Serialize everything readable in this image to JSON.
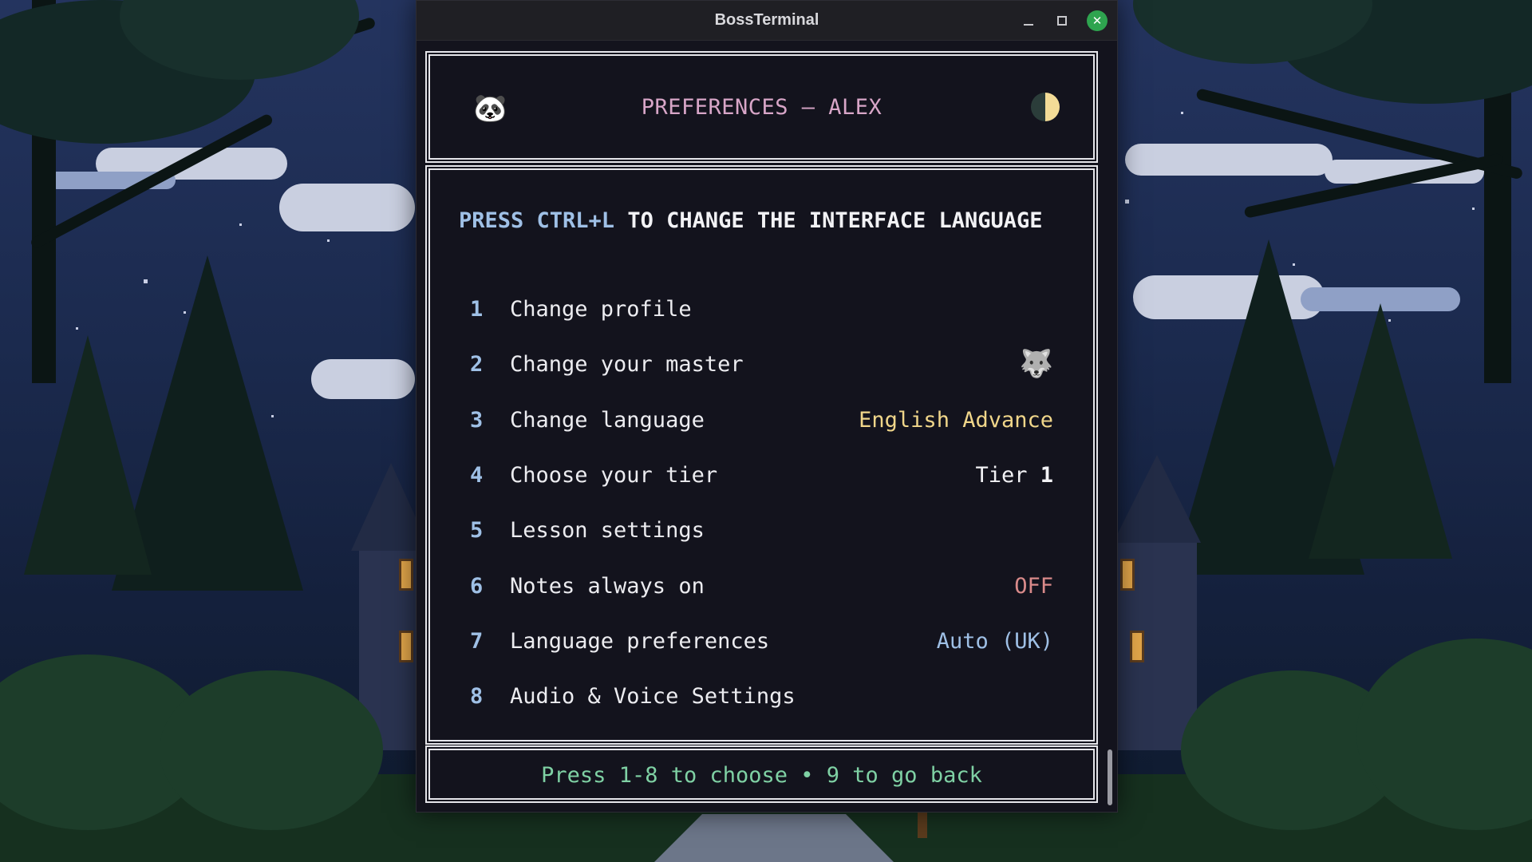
{
  "window": {
    "title": "BossTerminal"
  },
  "header": {
    "title": "PREFERENCES — ALEX",
    "left_icon": "🐼",
    "right_icon": "moon-icon"
  },
  "hint": {
    "shortcut": "PRESS CTRL+L",
    "text": " TO CHANGE THE INTERFACE LANGUAGE"
  },
  "menu": {
    "items": [
      {
        "num": "1",
        "label": "Change profile",
        "value": ""
      },
      {
        "num": "2",
        "label": "Change your master",
        "value": "",
        "icon": "🐺"
      },
      {
        "num": "3",
        "label": "Change language",
        "value": "English Advance"
      },
      {
        "num": "4",
        "label": "Choose your tier",
        "value_prefix": "Tier ",
        "value_strong": "1"
      },
      {
        "num": "5",
        "label": "Lesson settings",
        "value": ""
      },
      {
        "num": "6",
        "label": "Notes always on",
        "value": "OFF"
      },
      {
        "num": "7",
        "label": "Language preferences",
        "value": "Auto (UK)"
      },
      {
        "num": "8",
        "label": "Audio & Voice Settings",
        "value": ""
      }
    ]
  },
  "footer": {
    "hint": "Press 1-8 to choose • 9 to go back"
  },
  "colors": {
    "title": "#d8a6c8",
    "shortcut": "#9fc0e6",
    "language_value": "#f0d68a",
    "off_value": "#d98a8a",
    "footer_hint": "#7fd1a4",
    "close_button": "#2ea44f"
  }
}
